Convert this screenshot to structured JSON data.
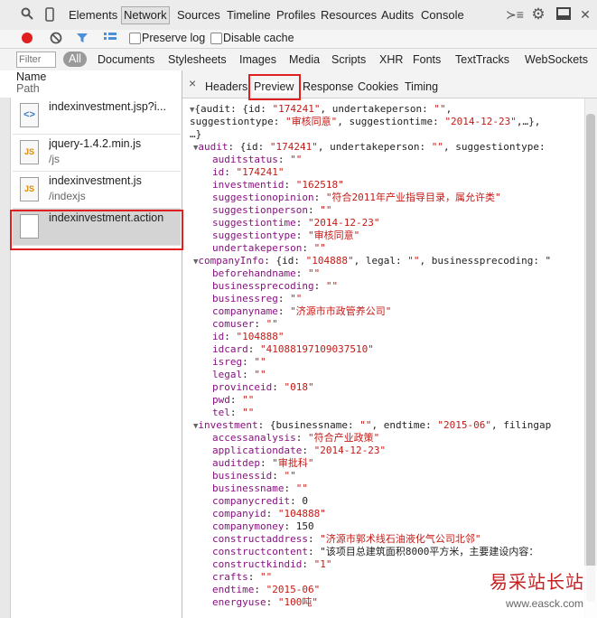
{
  "toolbar": {
    "tabs": [
      {
        "label": "Elements"
      },
      {
        "label": "Network"
      },
      {
        "label": "Sources"
      },
      {
        "label": "Timeline"
      },
      {
        "label": "Profiles"
      },
      {
        "label": "Resources"
      },
      {
        "label": "Audits"
      },
      {
        "label": "Console"
      }
    ],
    "selected_tab": "Network"
  },
  "network_bar": {
    "preserve_log": "Preserve log",
    "disable_cache": "Disable cache"
  },
  "filter_bar": {
    "placeholder": "Filter",
    "types": [
      "All",
      "Documents",
      "Stylesheets",
      "Images",
      "Media",
      "Scripts",
      "XHR",
      "Fonts",
      "TextTracks",
      "WebSockets"
    ]
  },
  "list": {
    "col_name": "Name",
    "col_path": "Path",
    "items": [
      {
        "name": "indexinvestment.jsp?i...",
        "path": "",
        "icon": "<>"
      },
      {
        "name": "jquery-1.4.2.min.js",
        "path": "/js",
        "icon": "JS"
      },
      {
        "name": "indexinvestment.js",
        "path": "/indexjs",
        "icon": "JS"
      },
      {
        "name": "indexinvestment.action",
        "path": "",
        "icon": ""
      }
    ]
  },
  "detail_tabs": {
    "close": "×",
    "tabs": [
      "Headers",
      "Preview",
      "Response",
      "Cookies",
      "Timing"
    ],
    "selected": "Preview"
  },
  "preview_lines": [
    "▼{audit: {id: \"174241\", undertakeperson: \"\",",
    "suggestiontype: \"审核同意\", suggestiontime: \"2014-12-23\",…},",
    "…}",
    "▼audit: {id: \"174241\", undertakeperson: \"\", suggestiontype:",
    "auditstatus: \"\"",
    "id: \"174241\"",
    "investmentid: \"162518\"",
    "suggestionopinion: \"符合2011年产业指导目录，属允许类\"",
    "suggestionperson: \"\"",
    "suggestiontime: \"2014-12-23\"",
    "suggestiontype: \"审核同意\"",
    "undertakeperson: \"\"",
    "▼companyInfo: {id: \"104888\", legal: \"\", businessprecoding: \"",
    "beforehandname: \"\"",
    "businessprecoding: \"\"",
    "businessreg: \"\"",
    "companyname: \"济源市市政管养公司\"",
    "comuser: \"\"",
    "id: \"104888\"",
    "idcard: \"41088197109037510\"",
    "isreg: \"\"",
    "legal: \"\"",
    "provinceid: \"018\"",
    "pwd: \"\"",
    "tel: \"\"",
    "▼investment: {businessname: \"\", endtime: \"2015-06\", filingap",
    "accessanalysis: \"符合产业政策\"",
    "applicationdate: \"2014-12-23\"",
    "auditdep: \"审批科\"",
    "businessid: \"\"",
    "businessname: \"\"",
    "companycredit: 0",
    "companyid: \"104888\"",
    "companymoney: 150",
    "constructaddress: \"济源市郭术线石油液化气公司北邻\"",
    "constructcontent: \"该项目总建筑面积8000平方米，主要建设内容：",
    "constructkindid: \"1\"",
    "crafts: \"\"",
    "endtime: \"2015-06\"",
    "energyuse: \"100吨\""
  ],
  "watermark": {
    "title": "易采站长站",
    "url": "www.easck.com"
  }
}
